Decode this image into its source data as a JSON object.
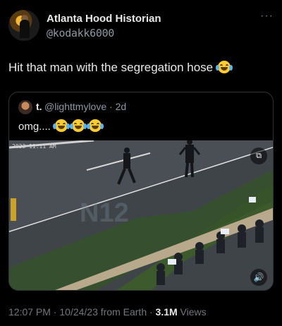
{
  "author": {
    "display_name": "Atlanta Hood Historian",
    "handle": "@kodakk6000"
  },
  "tweet": {
    "text": "Hit that man with the segregation hose",
    "emoji": "joy-emoji"
  },
  "quoted": {
    "display_name": "t.",
    "handle_time": "@lighttmylove · 2d",
    "text": "omg....",
    "emojis": [
      "joy-emoji",
      "joy-emoji",
      "loudly-crying-emoji"
    ],
    "video_timestamp": "2023 11:11 AM",
    "watermark": "N12"
  },
  "footer": {
    "meta": "12:07 PM · 10/24/23 from Earth · ",
    "views_count": "3.1M",
    "views_label": " Views"
  },
  "colors": {
    "background": "#000000",
    "text": "#e7e9ea",
    "secondary": "#8b98a5",
    "border": "#2f3336"
  }
}
